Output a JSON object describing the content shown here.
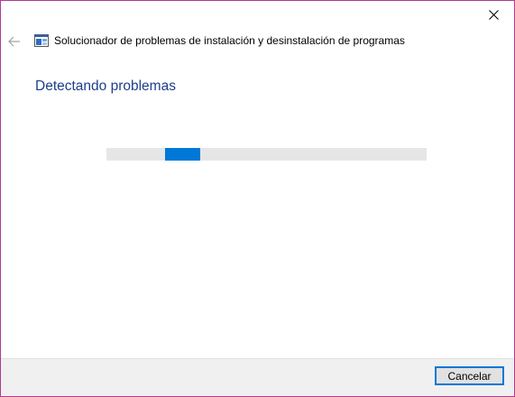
{
  "window": {
    "title": "Solucionador de problemas de instalación y desinstalación de programas",
    "accent_color": "#0078d7",
    "border_color": "#b03c8e"
  },
  "titlebar": {
    "close_icon": "close-icon",
    "back_icon": "back-arrow-icon",
    "app_icon": "troubleshooter-icon"
  },
  "main": {
    "heading": "Detectando problemas",
    "heading_color": "#1c3e8c",
    "progress": {
      "indeterminate": true,
      "chunk_start_fraction": 0.183,
      "chunk_fraction": 0.11
    }
  },
  "footer": {
    "cancel_label": "Cancelar"
  }
}
